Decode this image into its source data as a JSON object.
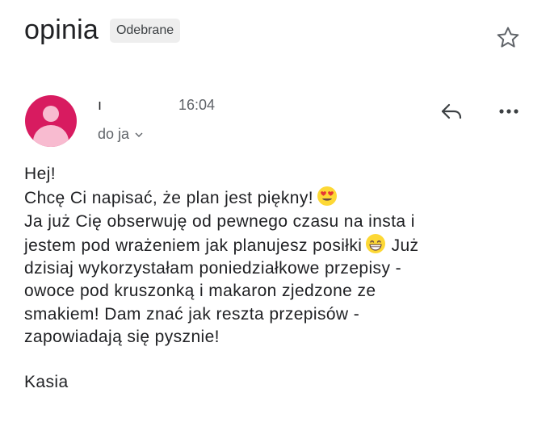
{
  "email": {
    "subject": "opinia",
    "label": "Odebrane",
    "sender_name": "ı",
    "time": "16:04",
    "recipient": "do ja",
    "body_lines": [
      "Hej!",
      "Chcę Ci napisać, że plan jest piękny!",
      "Ja już Cię obserwuję od pewnego czasu na insta i",
      "jestem pod wrażeniem jak planujesz posiłki",
      "Już",
      "dzisiaj wykorzystałam poniedziałkowe przepisy -",
      "owoce pod kruszonką i  makaron zjedzone ze",
      "smakiem!  Dam znać jak reszta przepisów -",
      "zapowiadają się pysznie!"
    ],
    "signature": "Kasia"
  },
  "icons": {
    "star": "star-icon",
    "reply": "reply-icon",
    "more": "more-vert-icon",
    "avatar": "avatar-person-icon",
    "emoji_1": "heart-eyes-emoji",
    "emoji_2": "grinning-emoji"
  },
  "colors": {
    "avatar_bg": "#d81b60",
    "avatar_fg": "#f8bbd0",
    "chip_bg": "#eeeeee",
    "text": "#202124",
    "secondary_text": "#5f6368"
  }
}
